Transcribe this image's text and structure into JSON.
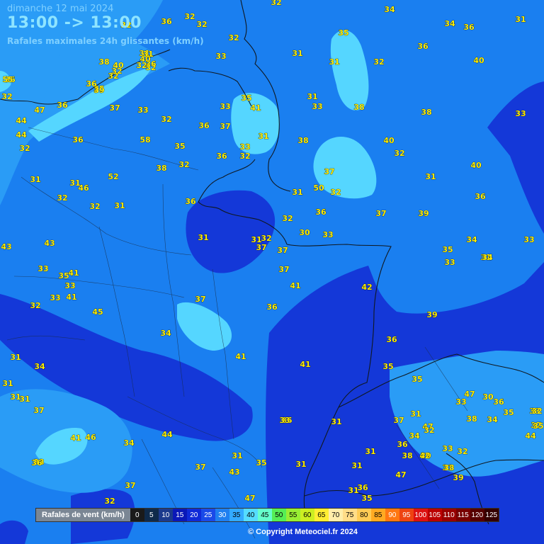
{
  "header": {
    "date": "dimanche 12 mai 2024",
    "time_range": "13:00 -> 13:00",
    "subtitle": "Rafales maximales 24h glissantes (km/h)"
  },
  "legend": {
    "title": "Rafales de vent (km/h)",
    "items": [
      {
        "label": "0",
        "color": "#1a1a1a",
        "text": "#ffffff"
      },
      {
        "label": "5",
        "color": "#0f2a4a",
        "text": "#ffffff"
      },
      {
        "label": "10",
        "color": "#1c3a8c",
        "text": "#ffffff"
      },
      {
        "label": "15",
        "color": "#0a18b8",
        "text": "#ffffff"
      },
      {
        "label": "20",
        "color": "#0f2ad8",
        "text": "#ffffff"
      },
      {
        "label": "25",
        "color": "#1a4ae8",
        "text": "#ffffff"
      },
      {
        "label": "30",
        "color": "#1f7ff0",
        "text": "#ffffff"
      },
      {
        "label": "35",
        "color": "#33aaff",
        "text": "#000000"
      },
      {
        "label": "40",
        "color": "#55dcff",
        "text": "#000000"
      },
      {
        "label": "45",
        "color": "#66ffcc",
        "text": "#000000"
      },
      {
        "label": "50",
        "color": "#55ee55",
        "text": "#000000"
      },
      {
        "label": "55",
        "color": "#99ee33",
        "text": "#000000"
      },
      {
        "label": "60",
        "color": "#ccee22",
        "text": "#000000"
      },
      {
        "label": "65",
        "color": "#ffee33",
        "text": "#000000"
      },
      {
        "label": "70",
        "color": "#ffeeaa",
        "text": "#000000"
      },
      {
        "label": "75",
        "color": "#ffdd88",
        "text": "#000000"
      },
      {
        "label": "80",
        "color": "#ffcc55",
        "text": "#000000"
      },
      {
        "label": "85",
        "color": "#ffaa22",
        "text": "#000000"
      },
      {
        "label": "90",
        "color": "#ff7711",
        "text": "#ffffff"
      },
      {
        "label": "95",
        "color": "#ee4411",
        "text": "#ffffff"
      },
      {
        "label": "100",
        "color": "#dd1111",
        "text": "#ffffff"
      },
      {
        "label": "105",
        "color": "#bb0000",
        "text": "#ffffff"
      },
      {
        "label": "110",
        "color": "#990000",
        "text": "#ffffff"
      },
      {
        "label": "115",
        "color": "#770000",
        "text": "#ffffff"
      },
      {
        "label": "120",
        "color": "#550000",
        "text": "#ffffff"
      },
      {
        "label": "125",
        "color": "#330000",
        "text": "#ffffff"
      }
    ]
  },
  "copyright": "© Copyright Meteociel.fr 2024",
  "values": [
    "32",
    "34",
    "36",
    "32",
    "32",
    "34",
    "36",
    "31",
    "32",
    "35",
    "32",
    "31",
    "36",
    "31",
    "32",
    "40",
    "33",
    "36",
    "32",
    "35",
    "32",
    "38",
    "31",
    "36",
    "32",
    "40",
    "55",
    "39",
    "32",
    "31",
    "32",
    "47",
    "36",
    "36",
    "37",
    "33",
    "40",
    "31",
    "33",
    "38",
    "38",
    "33",
    "44",
    "32",
    "33",
    "44",
    "35",
    "41",
    "32",
    "36",
    "31",
    "58",
    "38",
    "40",
    "36",
    "32",
    "35",
    "37",
    "33",
    "32",
    "38",
    "32",
    "52",
    "36",
    "40",
    "37",
    "31",
    "31",
    "31",
    "46",
    "31",
    "32",
    "50",
    "32",
    "36",
    "36",
    "32",
    "31",
    "37",
    "39",
    "36",
    "32",
    "30",
    "33",
    "31",
    "43",
    "43",
    "31",
    "34",
    "33",
    "35",
    "32",
    "37",
    "37",
    "33",
    "33",
    "35",
    "41",
    "31",
    "34",
    "33",
    "41",
    "37",
    "41",
    "42",
    "33",
    "45",
    "36",
    "37",
    "39",
    "32",
    "34",
    "36",
    "41",
    "31",
    "34",
    "41",
    "35",
    "35",
    "31",
    "31",
    "47",
    "31",
    "37",
    "33",
    "38",
    "34",
    "35",
    "36",
    "33",
    "37",
    "30",
    "32",
    "35",
    "44",
    "44",
    "41",
    "46",
    "34",
    "37",
    "31",
    "47",
    "35",
    "31",
    "33",
    "33",
    "34",
    "32",
    "33",
    "32",
    "36",
    "38",
    "30",
    "31",
    "31",
    "31",
    "31",
    "37",
    "43",
    "31",
    "39",
    "35",
    "47",
    "33",
    "36",
    "42",
    "36",
    "31",
    "35",
    "32",
    "37",
    "47"
  ]
}
